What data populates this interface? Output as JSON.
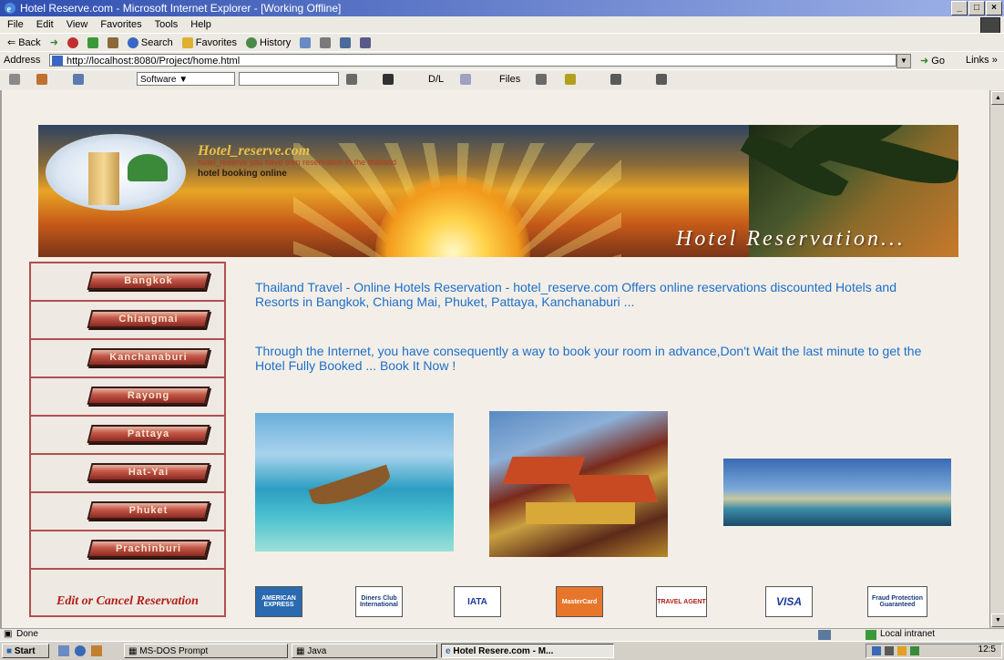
{
  "window": {
    "title": "Hotel Reserve.com - Microsoft Internet Explorer - [Working Offline]",
    "controls": [
      "_",
      "□",
      "×"
    ]
  },
  "menu": [
    "File",
    "Edit",
    "View",
    "Favorites",
    "Tools",
    "Help"
  ],
  "toolbar": {
    "back": "Back",
    "search": "Search",
    "favorites": "Favorites",
    "history": "History"
  },
  "address": {
    "label": "Address",
    "url": "http://localhost:8080/Project/home.html",
    "go": "Go",
    "links": "Links »"
  },
  "toolbar2": {
    "combo1": "Software",
    "dl": "D/L",
    "files": "Files"
  },
  "banner": {
    "site_name": "Hotel_reserve.com",
    "tagline": "hotel_reserve you have own reservation in the thailand",
    "subtitle": "hotel booking online",
    "heading": "Hotel Reservation..."
  },
  "sidebar": {
    "items": [
      {
        "label": "Bangkok"
      },
      {
        "label": "Chiangmai"
      },
      {
        "label": "Kanchanaburi"
      },
      {
        "label": "Rayong"
      },
      {
        "label": "Pattaya"
      },
      {
        "label": "Hat-Yai"
      },
      {
        "label": "Phuket"
      },
      {
        "label": "Prachinburi"
      }
    ],
    "edit_cancel": "Edit or Cancel Reservation"
  },
  "content": {
    "paragraph1": "Thailand Travel - Online Hotels Reservation - hotel_reserve.com Offers online reservations discounted Hotels and Resorts in Bangkok, Chiang Mai, Phuket, Pattaya, Kanchanaburi ...",
    "paragraph2": "Through the Internet, you have consequently a way to book your room in advance,Don't Wait the last minute to get the Hotel Fully Booked ... Book It Now !"
  },
  "payments": [
    {
      "label": "AMERICAN EXPRESS",
      "color": "#2a6ab0"
    },
    {
      "label": "Diners Club International",
      "color": "#ffffff"
    },
    {
      "label": "IATA",
      "color": "#ffffff"
    },
    {
      "label": "MasterCard",
      "color": "#e8762a"
    },
    {
      "label": "TRAVEL AGENT",
      "color": "#ffffff"
    },
    {
      "label": "VISA",
      "color": "#ffffff"
    },
    {
      "label": "Fraud Protection Guaranteed",
      "color": "#ffffff"
    }
  ],
  "status": {
    "left": "Done",
    "zone": "Local intranet"
  },
  "taskbar": {
    "start": "Start",
    "tasks": [
      "MS-DOS Prompt",
      "Java",
      "Hotel Resere.com - M..."
    ],
    "clock": "12:5"
  }
}
